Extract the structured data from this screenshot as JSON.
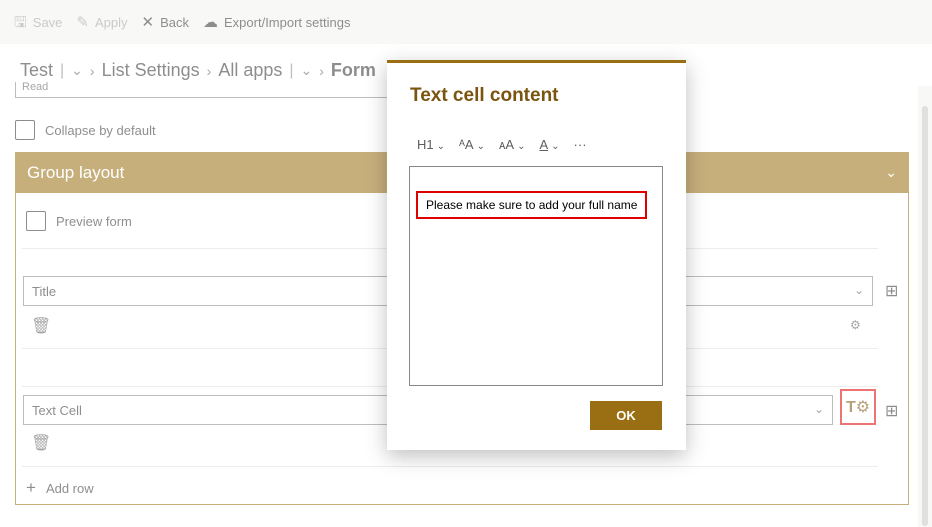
{
  "toolbar": {
    "save": "Save",
    "apply": "Apply",
    "back": "Back",
    "export": "Export/Import settings"
  },
  "breadcrumb": {
    "root": "Test",
    "list_settings": "List Settings",
    "all_apps": "All apps",
    "form": "Form"
  },
  "form": {
    "read_partial": "Read",
    "collapse_label": "Collapse by default",
    "group_title": "Group layout",
    "preview_label": "Preview form",
    "field1": "Title",
    "field2": "Text Cell",
    "add_row": "Add row"
  },
  "modal": {
    "title": "Text cell content",
    "format": {
      "heading": "H1",
      "more": "···"
    },
    "content": "Please make sure to add your full name",
    "ok": "OK"
  },
  "colors": {
    "accent": "#9a6e12",
    "highlight": "#e00000"
  }
}
